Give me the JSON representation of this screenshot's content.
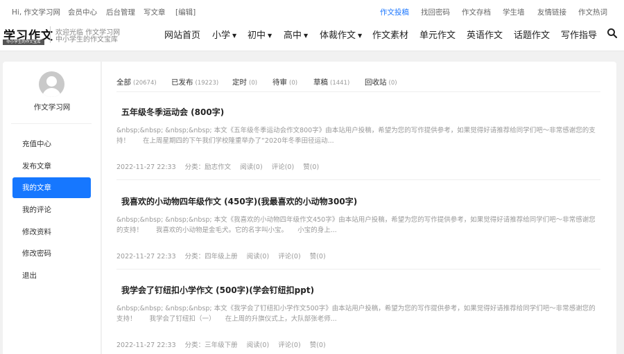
{
  "topbar": {
    "greeting": "Hi, 作文学习网",
    "member_center": "会员中心",
    "admin": "后台管理",
    "write": "写文章",
    "edit": "[编辑]",
    "submit": "作文投稿",
    "recover_password": "找回密码",
    "archive": "作文存档",
    "students": "学生墙",
    "friend_links": "友情链接",
    "hot_essays": "作文热词"
  },
  "header": {
    "logo_main": "学习作文",
    "logo_sub": "中小学生的作文宝库",
    "slogan_line1": "欢迎光临 作文学习网",
    "slogan_line2": "中小学生的作文宝库",
    "nav": [
      "网站首页",
      "小学",
      "初中",
      "高中",
      "体裁作文",
      "作文素材",
      "单元作文",
      "英语作文",
      "话题作文",
      "写作指导"
    ],
    "search_icon": "search-icon"
  },
  "sidebar": {
    "username": "作文学习网",
    "avatar_icon": "user-avatar-icon",
    "menu": [
      "充值中心",
      "发布文章",
      "我的文章",
      "我的评论",
      "修改资料",
      "修改密码",
      "退出"
    ],
    "active_index": 2,
    "accent_color": "#1677ff"
  },
  "tabs": [
    {
      "label": "全部",
      "count": "(20674)"
    },
    {
      "label": "已发布",
      "count": "(19223)"
    },
    {
      "label": "定时",
      "count": "(0)"
    },
    {
      "label": "待审",
      "count": "(0)"
    },
    {
      "label": "草稿",
      "count": "(1441)"
    },
    {
      "label": "回收站",
      "count": "(0)"
    }
  ],
  "posts": [
    {
      "title": "五年级冬季运动会 (800字)",
      "excerpt": "&nbsp;&nbsp; &nbsp;&nbsp; 本文《五年级冬季运动会作文800字》由本站用户投稿，希望为您的写作提供参考，如果觉得好请推荐给同学们吧～非常感谢您的支持！　　在上周星期四的下午我们学校隆重举办了“2020年冬季田径运动...",
      "date": "2022-11-27 22:33",
      "category": "分类：励志作文",
      "reads": "阅读(0)",
      "comments": "评论(0)",
      "likes": "赞(0)"
    },
    {
      "title": "我喜欢的小动物四年级作文 (450字)(我最喜欢的小动物300字)",
      "excerpt": "&nbsp;&nbsp; &nbsp;&nbsp; 本文《我喜欢的小动物四年级作文450字》由本站用户投稿，希望为您的写作提供参考，如果觉得好请推荐给同学们吧～非常感谢您的支持！　　我喜欢的小动物是金毛犬。它的名字叫小宝。　　小宝的身上...",
      "date": "2022-11-27 22:33",
      "category": "分类：四年级上册",
      "reads": "阅读(0)",
      "comments": "评论(0)",
      "likes": "赞(0)"
    },
    {
      "title": "我学会了钉纽扣小学作文 (500字)(学会钉纽扣ppt)",
      "excerpt": "&nbsp;&nbsp; &nbsp;&nbsp; 本文《我学会了钉纽扣小学作文500字》由本站用户投稿，希望为您的写作提供参考，如果觉得好请推荐给同学们吧～非常感谢您的支持！　　我学会了钉纽扣（一）　　在上周的升旗仪式上，大队部张老师...",
      "date": "2022-11-27 22:33",
      "category": "分类：三年级下册",
      "reads": "阅读(0)",
      "comments": "评论(0)",
      "likes": "赞(0)"
    }
  ]
}
